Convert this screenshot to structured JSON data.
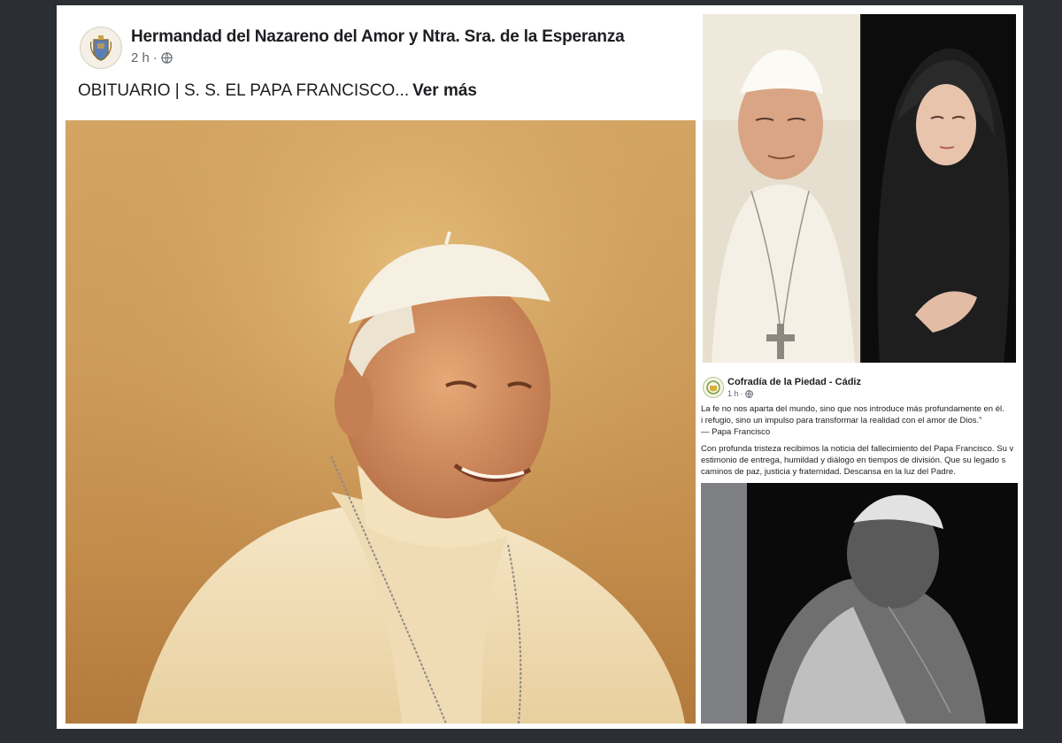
{
  "left_post": {
    "page_name": "Hermandad del Nazareno del Amor y Ntra. Sra. de la Esperanza",
    "time": "2 h",
    "text": "OBITUARIO | S. S. EL PAPA FRANCISCO...",
    "see_more": "Ver más",
    "icons": [
      "crest-avatar-icon",
      "globe-icon"
    ]
  },
  "right_post": {
    "page_name": "Cofradía de la Piedad - Cádiz",
    "time": "1 h",
    "quote_line1": "La fe no nos aparta del mundo, sino que nos introduce más profundamente en él.",
    "quote_line2": "i refugio, sino un impulso para transformar la realidad con el amor de Dios.\"",
    "quote_author": "— Papa Francisco",
    "body_line1": "Con profunda tristeza recibimos la noticia del fallecimiento del Papa Francisco. Su v",
    "body_line2": "estimonio de entrega, humildad y diálogo en tiempos de división. Que su legado s",
    "body_line3": "caminos de paz, justicia y fraternidad. Descansa en la luz del Padre.",
    "icons": [
      "crest-avatar-icon",
      "globe-icon"
    ]
  },
  "colors": {
    "background": "#2b2e33",
    "panel": "#ffffff",
    "text_primary": "#1c1e21",
    "text_secondary": "#606770"
  }
}
